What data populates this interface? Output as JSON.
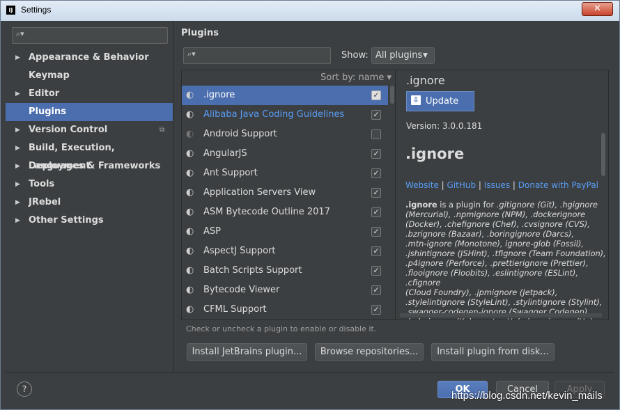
{
  "window": {
    "title": "Settings",
    "app_icon": "IJ",
    "close_icon": "close-icon"
  },
  "sidebar": {
    "search_placeholder": "",
    "items": [
      {
        "label": "Appearance & Behavior",
        "expandable": true
      },
      {
        "label": "Keymap",
        "expandable": false
      },
      {
        "label": "Editor",
        "expandable": true
      },
      {
        "label": "Plugins",
        "expandable": false,
        "selected": true
      },
      {
        "label": "Version Control",
        "expandable": true,
        "has_copy_icon": true
      },
      {
        "label": "Build, Execution, Deployment",
        "expandable": true
      },
      {
        "label": "Languages & Frameworks",
        "expandable": true
      },
      {
        "label": "Tools",
        "expandable": true
      },
      {
        "label": "JRebel",
        "expandable": true
      },
      {
        "label": "Other Settings",
        "expandable": true
      }
    ]
  },
  "plugins": {
    "section_title": "Plugins",
    "search_placeholder": "",
    "show_label": "Show:",
    "show_value": "All plugins",
    "sort_label": "Sort by: name ▾",
    "list": [
      {
        "name": ".ignore",
        "checked": true,
        "selected": true
      },
      {
        "name": "Alibaba Java Coding Guidelines",
        "checked": true,
        "link": true
      },
      {
        "name": "Android Support",
        "checked": false,
        "dim": true
      },
      {
        "name": "AngularJS",
        "checked": true
      },
      {
        "name": "Ant Support",
        "checked": true
      },
      {
        "name": "Application Servers View",
        "checked": true
      },
      {
        "name": "ASM Bytecode Outline 2017",
        "checked": true
      },
      {
        "name": "ASP",
        "checked": true
      },
      {
        "name": "AspectJ Support",
        "checked": true
      },
      {
        "name": "Batch Scripts Support",
        "checked": true
      },
      {
        "name": "Bytecode Viewer",
        "checked": true
      },
      {
        "name": "CFML Support",
        "checked": true
      }
    ],
    "hint": "Check or uncheck a plugin to enable or disable it.",
    "buttons": {
      "install_jetbrains": "Install JetBrains plugin...",
      "browse": "Browse repositories...",
      "install_disk": "Install plugin from disk..."
    }
  },
  "detail": {
    "name": ".ignore",
    "update_label": "Update",
    "version": "Version: 3.0.0.181",
    "title": ".ignore",
    "links": [
      "Website",
      "GitHub",
      "Issues",
      "Donate with PayPal"
    ],
    "desc_strong": ".ignore",
    "desc_lead": " is a plugin for ",
    "desc_lines": [
      ".gitignore (Git), .hgignore",
      "(Mercurial), .npmignore (NPM), .dockerignore",
      "(Docker), .chefignore (Chef), .cvsignore (CVS),",
      ".bzrignore (Bazaar), .boringignore (Darcs),",
      ".mtn-ignore (Monotone), ignore-glob (Fossil),",
      ".jshintignore (JSHint), .tfignore (Team Foundation),",
      ".p4ignore (Perforce), .prettierignore (Prettier),",
      ".flooignore (Floobits), .eslintignore (ESLint), .cfignore",
      "(Cloud Foundry), .jpmignore (Jetpack),",
      ".stylelintignore (StyleLint), .stylintignore (Stylint),",
      ".swagger-codegen-ignore (Swagger Codegen),",
      ".helmignore (Kubernetes Helm), .upignore (Up),"
    ]
  },
  "footer": {
    "help": "?",
    "ok": "OK",
    "cancel": "Cancel",
    "apply": "Apply"
  },
  "watermark": "https://blog.csdn.net/kevin_mails"
}
